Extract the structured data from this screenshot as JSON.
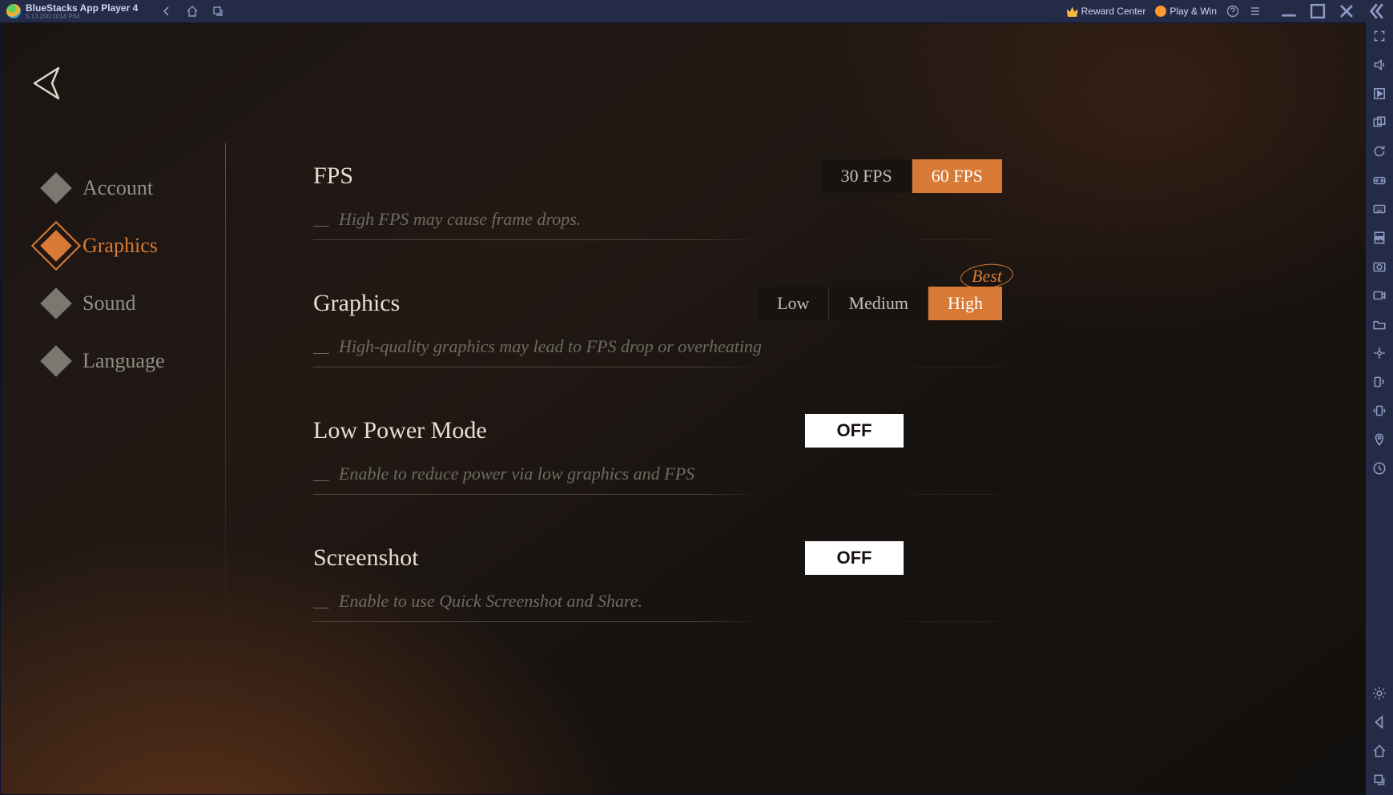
{
  "titlebar": {
    "app_name": "BlueStacks App Player 4",
    "app_version": "5.13.200.1014  P64",
    "reward_center": "Reward Center",
    "play_win": "Play & Win"
  },
  "sidebar": {
    "items": [
      {
        "label": "Account"
      },
      {
        "label": "Graphics"
      },
      {
        "label": "Sound"
      },
      {
        "label": "Language"
      }
    ],
    "active_index": 1
  },
  "settings": {
    "fps": {
      "title": "FPS",
      "desc": "High FPS may cause frame drops.",
      "options": [
        "30 FPS",
        "60 FPS"
      ],
      "selected": "60 FPS"
    },
    "graphics": {
      "title": "Graphics",
      "desc": "High-quality graphics may lead to FPS drop or overheating",
      "options": [
        "Low",
        "Medium",
        "High"
      ],
      "selected": "High",
      "badge": "Best"
    },
    "low_power": {
      "title": "Low Power Mode",
      "desc": "Enable to reduce power via low graphics and FPS",
      "value": "OFF"
    },
    "screenshot": {
      "title": "Screenshot",
      "desc": "Enable to use Quick Screenshot and Share.",
      "value": "OFF"
    }
  }
}
